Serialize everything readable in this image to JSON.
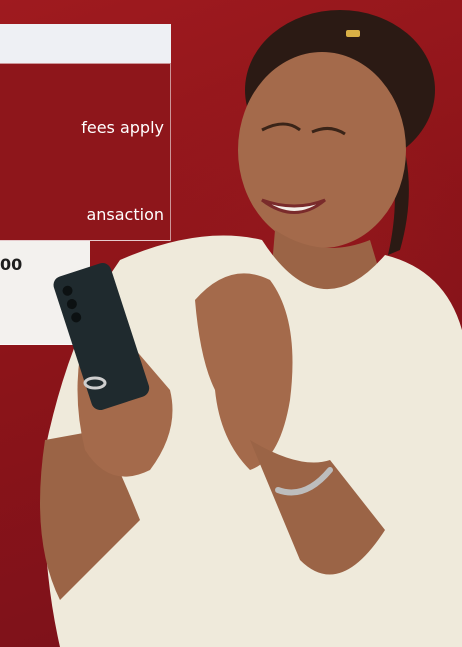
{
  "panel": {
    "fee_line_1": "fees apply",
    "fee_line_2": "ansaction",
    "amount_fragment": "00"
  }
}
